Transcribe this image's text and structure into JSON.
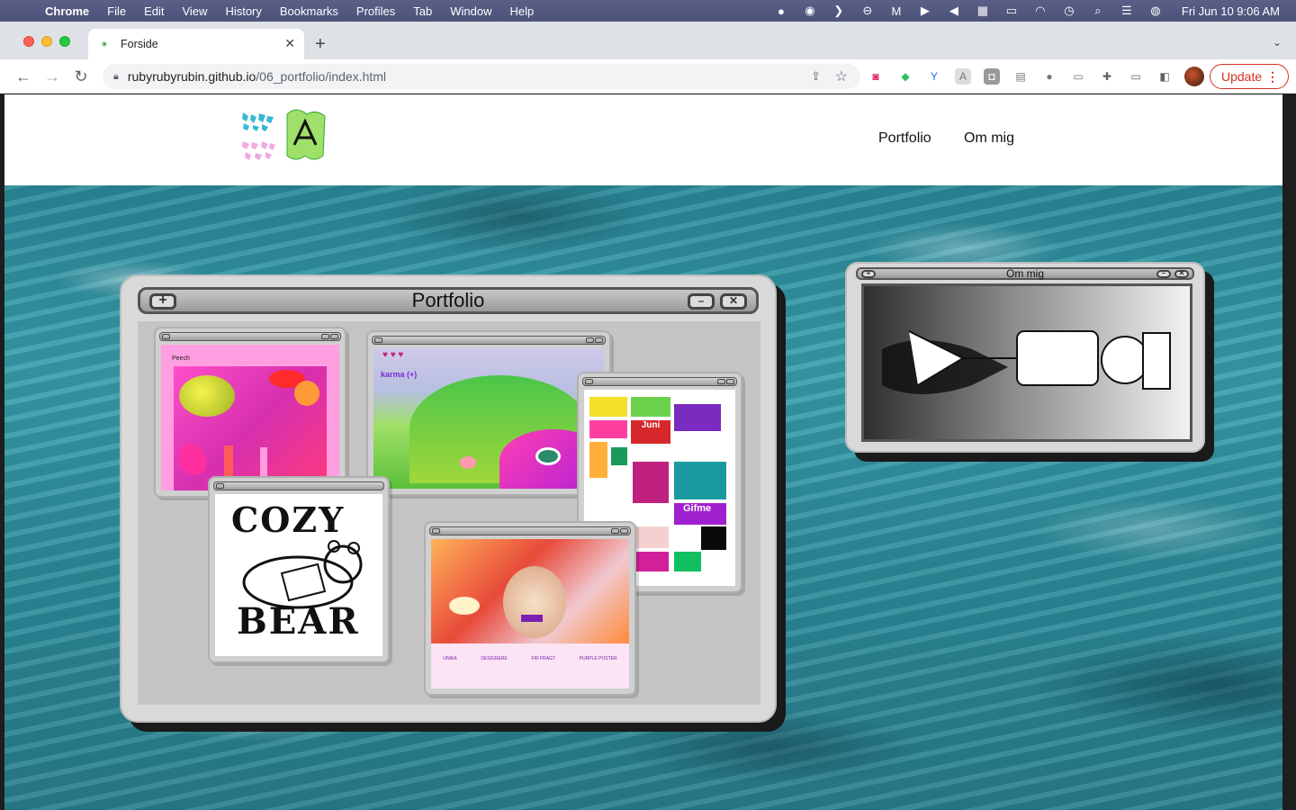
{
  "menubar": {
    "apple": "",
    "items": [
      "Chrome",
      "File",
      "Edit",
      "View",
      "History",
      "Bookmarks",
      "Profiles",
      "Tab",
      "Window",
      "Help"
    ],
    "clock": "Fri Jun 10  9:06 AM"
  },
  "browser": {
    "tab_title": "Forside",
    "url_host": "rubyrubyrubin.github.io",
    "url_path": "/06_portfolio/index.html",
    "update_label": "Update"
  },
  "site": {
    "nav": {
      "portfolio": "Portfolio",
      "om_mig": "Om mig"
    },
    "portfolio_window": {
      "title": "Portfolio",
      "thumbs": {
        "peech": "Peech",
        "karma": "karma (+)",
        "cozy_top": "COZY",
        "cozy_bottom": "BEAR",
        "gifme": "Gifme",
        "juni": "Juni"
      },
      "shop_features": [
        "UNIKA",
        "DESIGNERE",
        "FRI FRAGT",
        "PURPLE POSTER"
      ]
    },
    "about_window": {
      "title": "Om mig"
    }
  },
  "colors": {
    "update_red": "#d93025",
    "ocean": "#2f8e9c",
    "window_grey": "#d9d9d9"
  }
}
